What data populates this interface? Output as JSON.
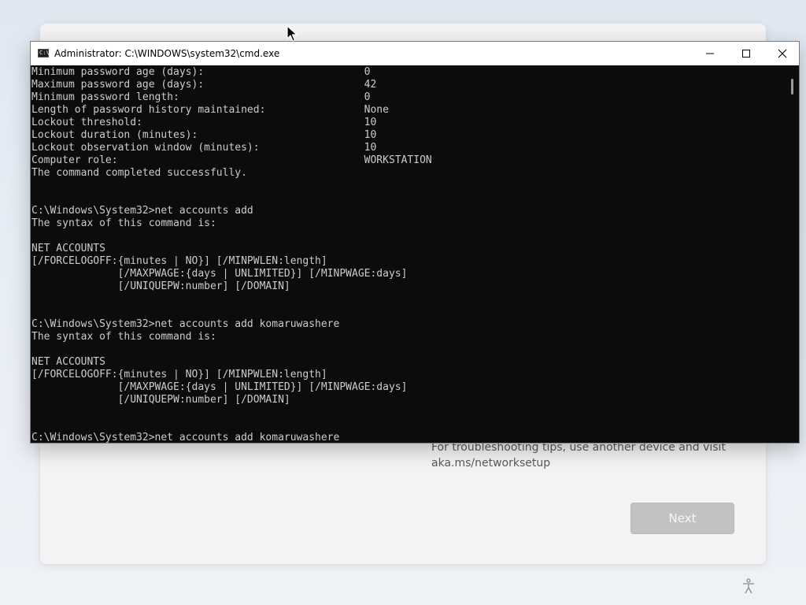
{
  "oobe": {
    "help_text": "For troubleshooting tips, use another device and visit aka.ms/networksetup",
    "next_label": "Next"
  },
  "window": {
    "title": "Administrator: C:\\WINDOWS\\system32\\cmd.exe",
    "icon_text": "C:\\"
  },
  "console": {
    "lines": [
      "Minimum password age (days):                          0",
      "Maximum password age (days):                          42",
      "Minimum password length:                              0",
      "Length of password history maintained:                None",
      "Lockout threshold:                                    10",
      "Lockout duration (minutes):                           10",
      "Lockout observation window (minutes):                 10",
      "Computer role:                                        WORKSTATION",
      "The command completed successfully.",
      "",
      "",
      "C:\\Windows\\System32>net accounts add",
      "The syntax of this command is:",
      "",
      "NET ACCOUNTS",
      "[/FORCELOGOFF:{minutes | NO}] [/MINPWLEN:length]",
      "              [/MAXPWAGE:{days | UNLIMITED}] [/MINPWAGE:days]",
      "              [/UNIQUEPW:number] [/DOMAIN]",
      "",
      "",
      "C:\\Windows\\System32>net accounts add komaruwashere",
      "The syntax of this command is:",
      "",
      "NET ACCOUNTS",
      "[/FORCELOGOFF:{minutes | NO}] [/MINPWLEN:length]",
      "              [/MAXPWAGE:{days | UNLIMITED}] [/MINPWAGE:days]",
      "              [/UNIQUEPW:number] [/DOMAIN]",
      "",
      "",
      "C:\\Windows\\System32>net accounts add komaruwashere"
    ]
  },
  "icons": {
    "minimize": "minimize-icon",
    "maximize": "maximize-icon",
    "close": "close-icon",
    "accessibility": "accessibility-icon",
    "cursor": "mouse-pointer-icon"
  }
}
